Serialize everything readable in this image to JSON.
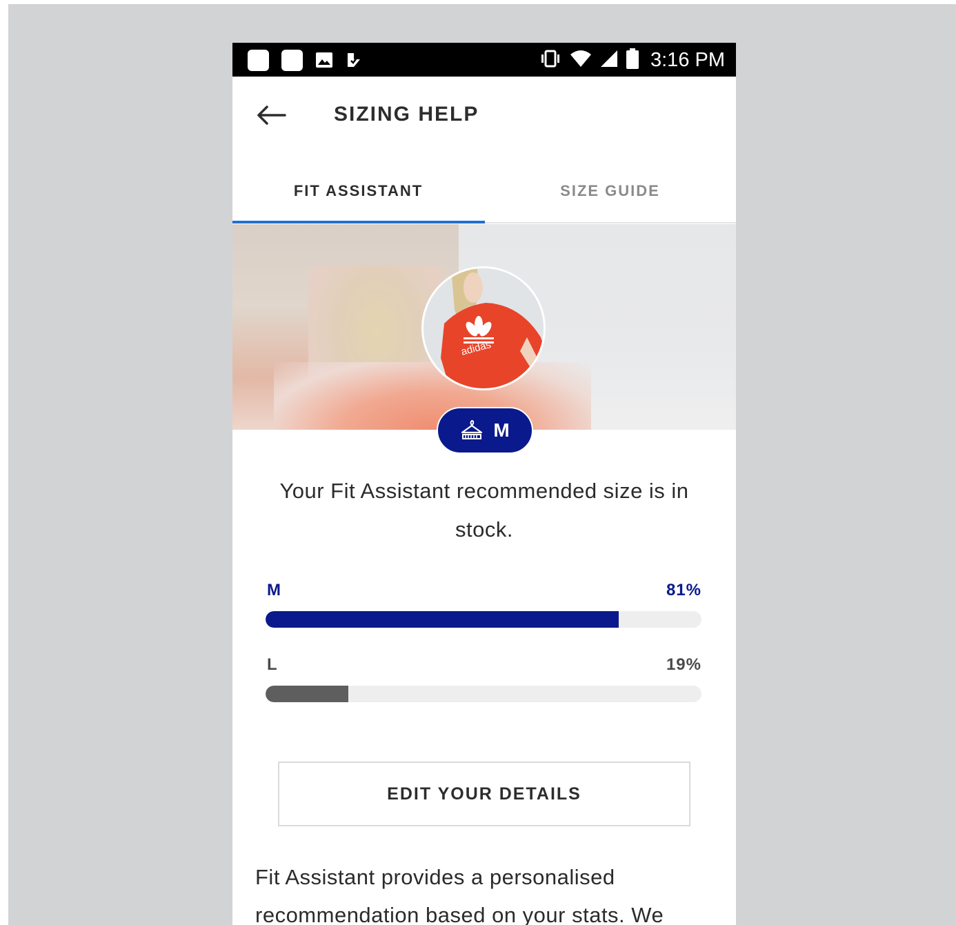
{
  "status_bar": {
    "time": "3:16 PM",
    "left_icons": [
      "app-icon",
      "app-icon",
      "image-icon",
      "download-check-icon"
    ],
    "right_icons": [
      "vibrate-icon",
      "wifi-icon",
      "signal-icon",
      "battery-icon"
    ]
  },
  "header": {
    "title": "SIZING HELP",
    "back_icon": "arrow-left-icon"
  },
  "tabs": [
    {
      "label": "FIT ASSISTANT",
      "active": true
    },
    {
      "label": "SIZE GUIDE",
      "active": false
    }
  ],
  "recommendation": {
    "badge_icon": "hanger-icon",
    "badge_size": "M",
    "message": "Your Fit Assistant recommended size is in stock."
  },
  "sizes": [
    {
      "label": "M",
      "percent_text": "81%",
      "percent": 81,
      "color": "#0a1a8c"
    },
    {
      "label": "L",
      "percent_text": "19%",
      "percent": 19,
      "color": "#5e5e5e"
    }
  ],
  "edit_button": {
    "label": "EDIT YOUR DETAILS"
  },
  "info": {
    "text": "Fit Assistant provides a personalised recommendation based on your stats. We"
  },
  "colors": {
    "accent_blue": "#0a1a8c",
    "tab_indicator": "#1f6fd0",
    "background": "#d2d3d5"
  }
}
